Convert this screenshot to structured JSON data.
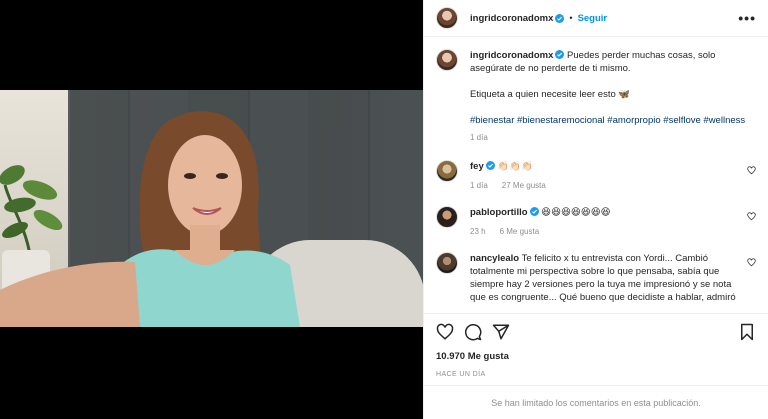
{
  "header": {
    "username": "ingridcoronadomx",
    "dot": "•",
    "follow_label": "Seguir",
    "more_label": "•••"
  },
  "caption": {
    "username": "ingridcoronadomx",
    "text_line1": "Puedes perder muchas cosas, solo",
    "text_line2": "asegúrate de no perderte de ti mismo.",
    "text_line3": "Etiqueta a quien necesite leer esto 🦋",
    "hashtags": "#bienestar #bienestaremocional #amorpropio #selflove #wellness",
    "time": "1 día"
  },
  "comments": [
    {
      "username": "fey",
      "text": "👏🏻👏🏻👏🏻",
      "time": "1 día",
      "likes": "27 Me gusta",
      "verified": true
    },
    {
      "username": "pabloportillo",
      "text": "😆😆😆😆😆😆😆",
      "time": "23 h",
      "likes": "6 Me gusta",
      "verified": true
    },
    {
      "username": "nancylealo",
      "text": "Te felicito x tu entrevista con Yordi... Cambió totalmente mi perspectiva sobre lo que pensaba, sabía que siempre hay 2 versiones pero la tuya me impresionó y se nota que es congruente... Qué bueno que decidiste a hablar, admiró",
      "verified": false
    }
  ],
  "actions": [
    "heart-icon",
    "comment-icon",
    "share-icon",
    "bookmark-icon"
  ],
  "likes_count": "10.970 Me gusta",
  "posted_ago": "HACE UN DÍA",
  "footer_text": "Se han limitado los comentarios en esta publicación.",
  "colors": {
    "link": "#0095f6",
    "hashtag": "#00376b",
    "muted": "#8e8e8e",
    "verified": "#1d9bf0"
  }
}
